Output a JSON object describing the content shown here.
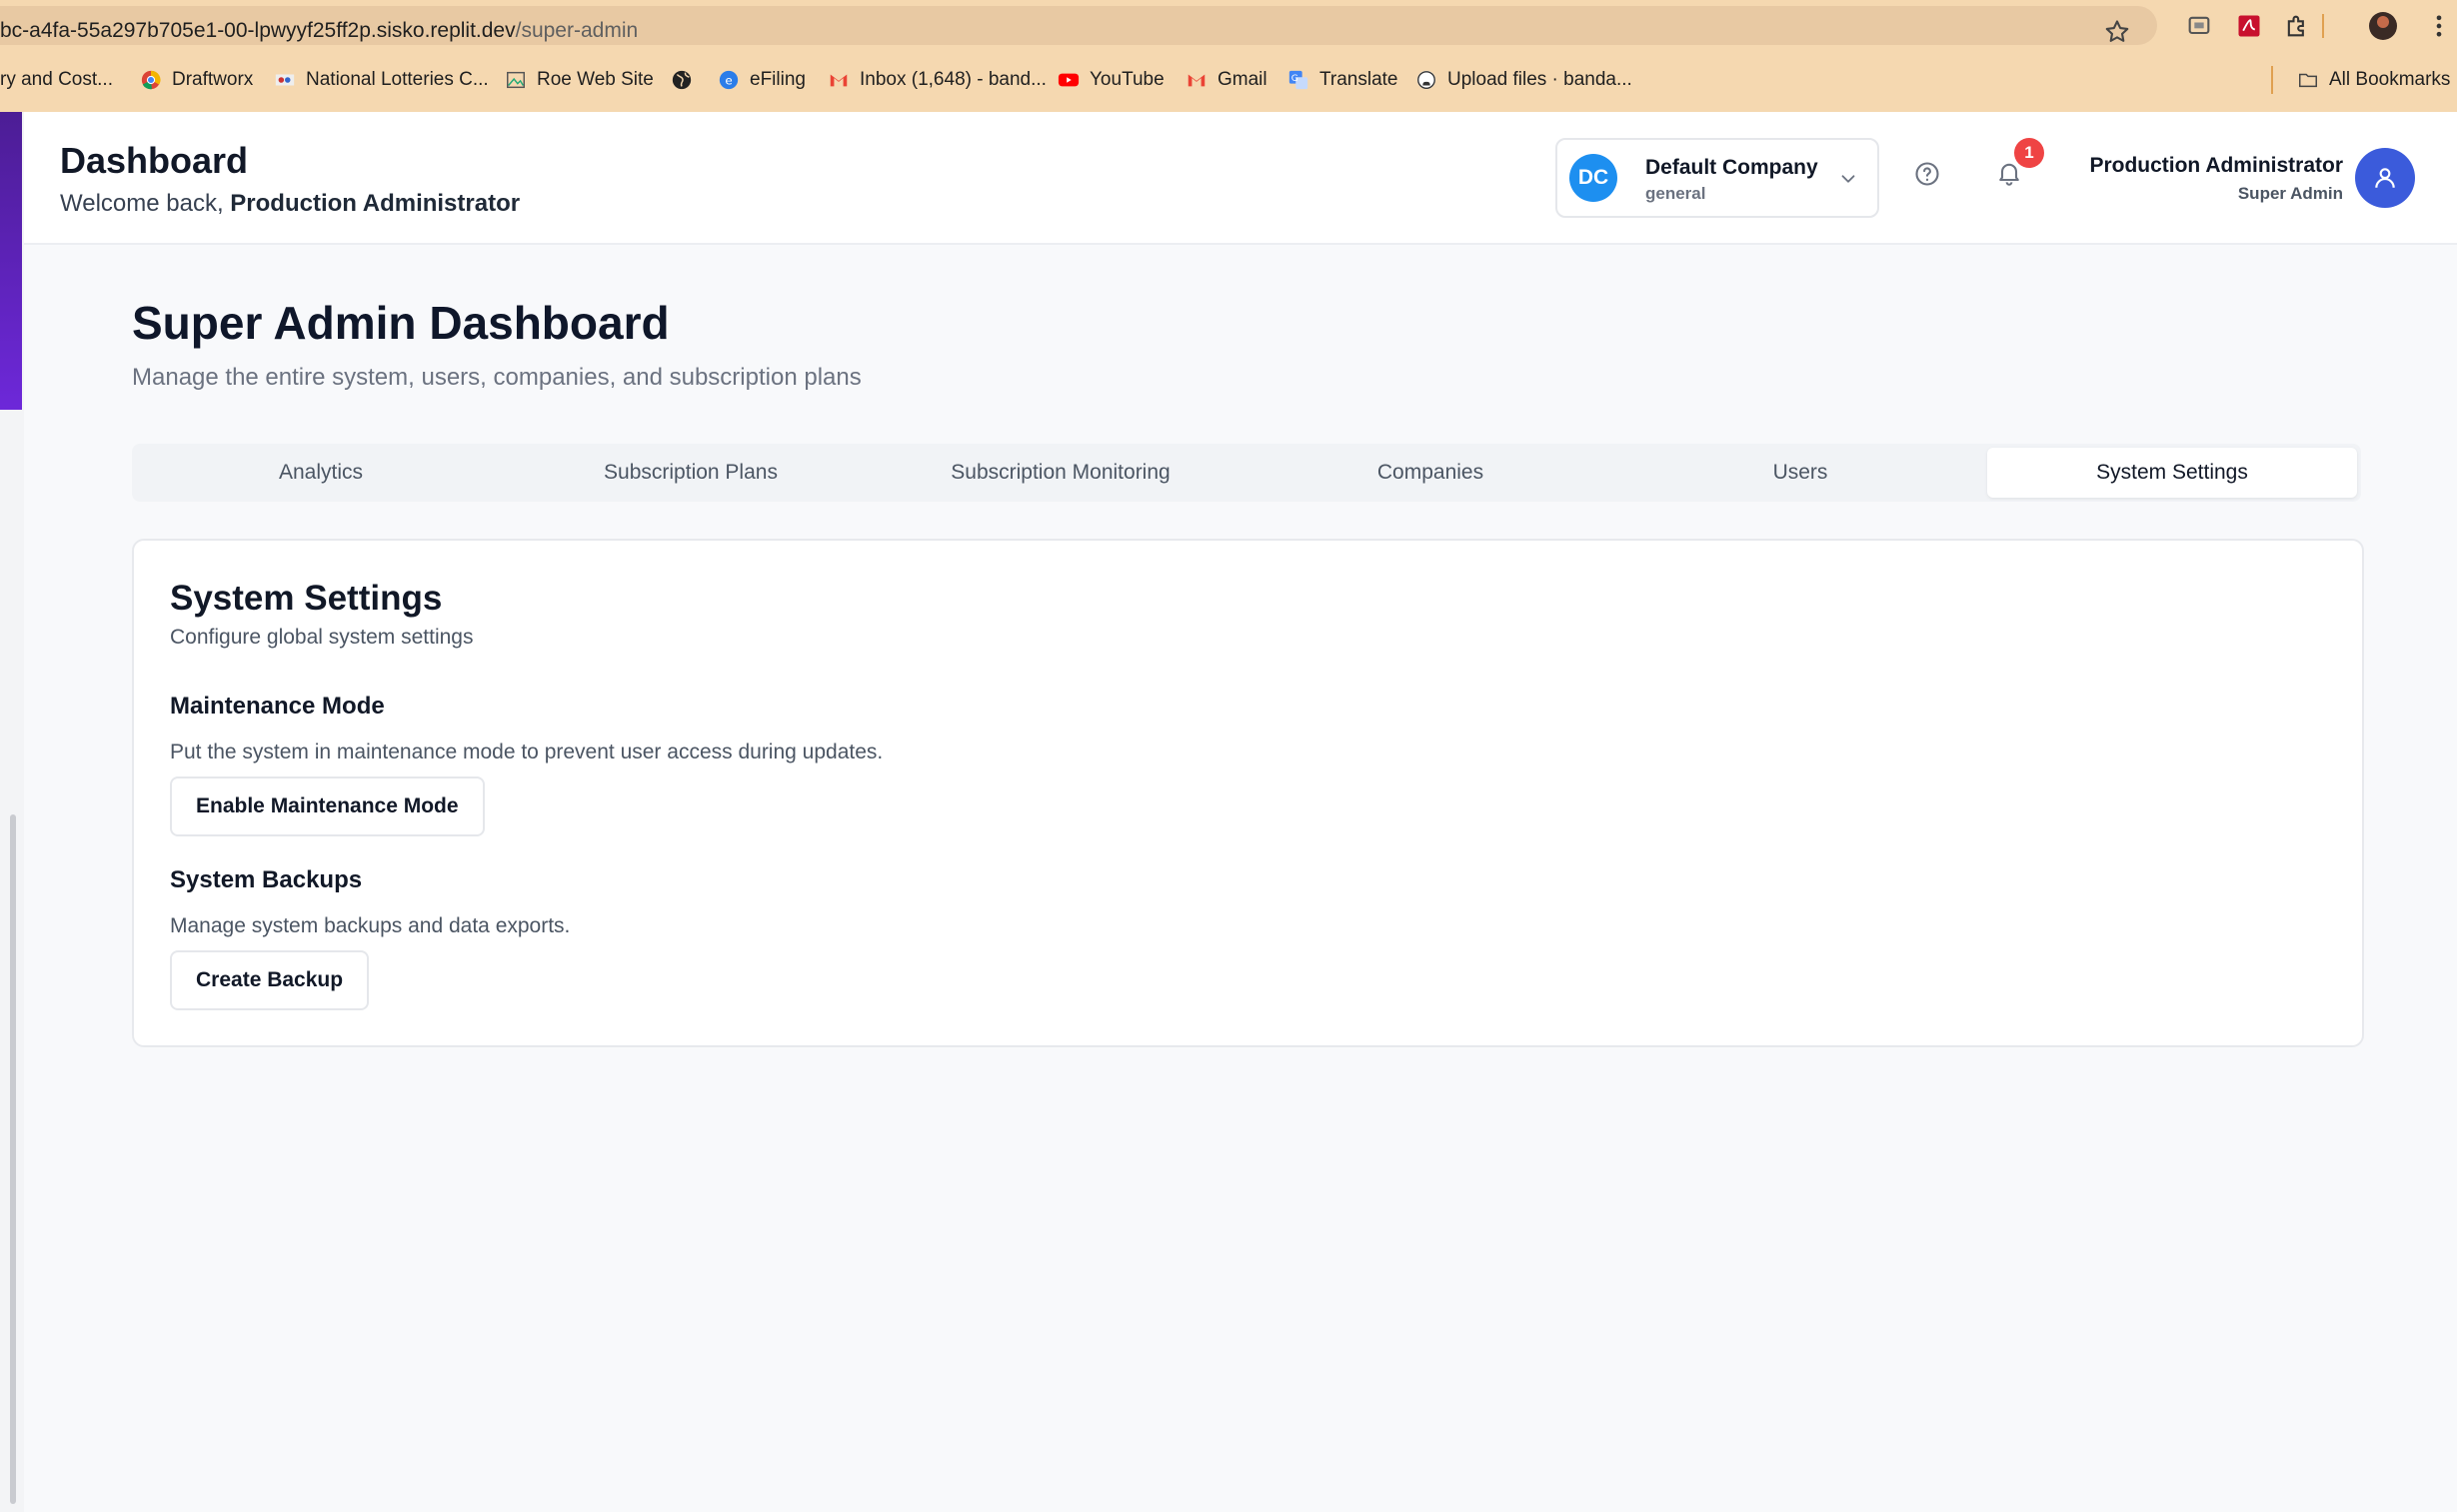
{
  "browser": {
    "url_host": "bc-a4fa-55a297b705e1-00-lpwyyf25ff2p.sisko.replit.dev",
    "url_path": "/super-admin",
    "bookmarks": [
      "ry and Cost...",
      "Draftworx",
      "National Lotteries C...",
      "Roe Web Site",
      "",
      "eFiling",
      "Inbox (1,648) - band...",
      "YouTube",
      "Gmail",
      "Translate",
      "Upload files · banda..."
    ],
    "all_bookmarks": "All Bookmarks"
  },
  "header": {
    "title": "Dashboard",
    "welcome_prefix": "Welcome back, ",
    "welcome_name": "Production Administrator",
    "company": {
      "initials": "DC",
      "name": "Default Company",
      "sub": "general"
    },
    "notification_count": "1",
    "user_name": "Production Administrator",
    "user_role": "Super Admin"
  },
  "page": {
    "title": "Super Admin Dashboard",
    "subtitle": "Manage the entire system, users, companies, and subscription plans"
  },
  "tabs": [
    {
      "label": "Analytics",
      "active": false
    },
    {
      "label": "Subscription Plans",
      "active": false
    },
    {
      "label": "Subscription Monitoring",
      "active": false
    },
    {
      "label": "Companies",
      "active": false
    },
    {
      "label": "Users",
      "active": false
    },
    {
      "label": "System Settings",
      "active": true
    }
  ],
  "settings": {
    "title": "System Settings",
    "subtitle": "Configure global system settings",
    "maintenance": {
      "title": "Maintenance Mode",
      "description": "Put the system in maintenance mode to prevent user access during updates.",
      "button": "Enable Maintenance Mode"
    },
    "backups": {
      "title": "System Backups",
      "description": "Manage system backups and data exports.",
      "button": "Create Backup"
    }
  },
  "colors": {
    "browser_chrome": "#f5d8b0",
    "accent_blue": "#3b5bdb",
    "company_avatar": "#1d8ff0",
    "badge_red": "#ef4444",
    "sidebar_purple": "#5b21b6"
  }
}
